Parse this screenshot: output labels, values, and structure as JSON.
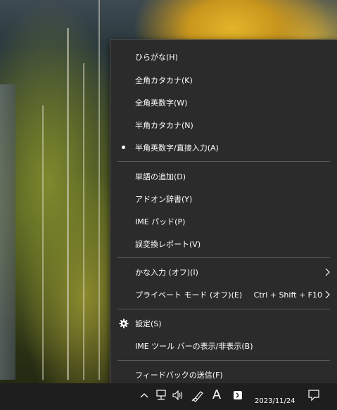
{
  "menu": {
    "items": [
      {
        "label": "ひらがな(H)"
      },
      {
        "label": "全角カタカナ(K)"
      },
      {
        "label": "全角英数字(W)"
      },
      {
        "label": "半角カタカナ(N)"
      },
      {
        "label": "半角英数字/直接入力(A)",
        "selected": true
      },
      {
        "label": "単語の追加(D)"
      },
      {
        "label": "アドオン辞書(Y)"
      },
      {
        "label": "IME パッド(P)"
      },
      {
        "label": "誤変換レポート(V)"
      },
      {
        "label": "かな入力 (オフ)(I)",
        "submenu": true
      },
      {
        "label": "プライベート モード (オフ)(E)",
        "shortcut": "Ctrl + Shift + F10",
        "submenu": true
      },
      {
        "label": "設定(S)",
        "icon": "gear-icon"
      },
      {
        "label": "IME ツール バーの表示/非表示(B)"
      },
      {
        "label": "フィードバックの送信(F)"
      }
    ]
  },
  "taskbar": {
    "ime_mode": "A",
    "date": "2023/11/24",
    "icons": [
      "chevron-up-icon",
      "network-icon",
      "volume-icon",
      "pen-icon",
      "ime-mode-icon",
      "ime-dictionary-icon",
      "notification-icon"
    ]
  },
  "colors": {
    "menu_bg": "#2b2b2b",
    "menu_text": "#ffffff",
    "taskbar_bg": "#1e1e1e"
  }
}
